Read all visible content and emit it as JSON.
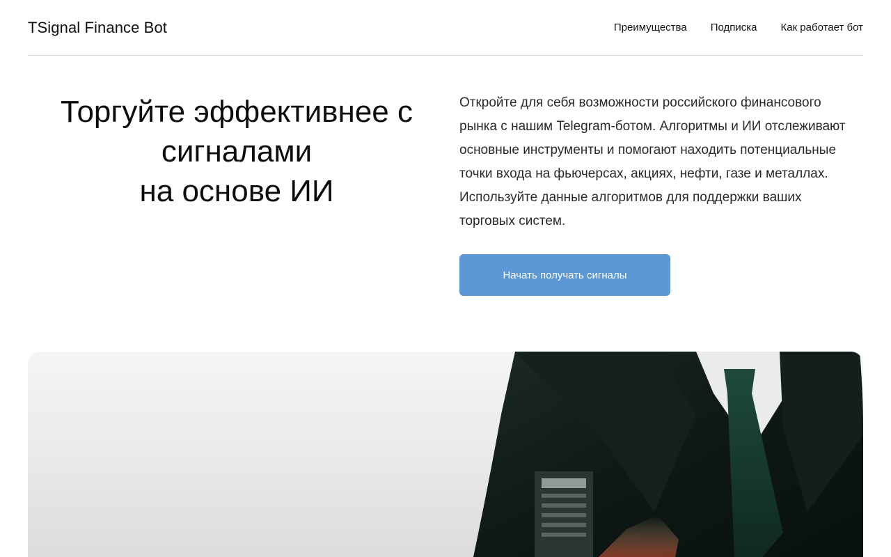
{
  "header": {
    "brand": "TSignal Finance Bot",
    "nav": [
      {
        "label": "Преимущества"
      },
      {
        "label": "Подписка"
      },
      {
        "label": "Как работает бот"
      }
    ]
  },
  "hero": {
    "title_lines": [
      "Торгуйте эффективнее с",
      "сигналами",
      "на основе ИИ"
    ],
    "description": "Откройте для себя возможности российского финансового рынка с нашим Telegram-ботом. Алгоритмы и ИИ отслеживают основные инструменты и помогают находить потенциальные точки входа на фьючерсах, акциях, нефти, газе и металлах. Используйте данные алгоритмов для поддержки ваших торговых систем.",
    "cta_label": "Начать получать сигналы"
  },
  "colors": {
    "accent": "#5b98d5",
    "text": "#111111",
    "divider": "#d6d6d6"
  }
}
